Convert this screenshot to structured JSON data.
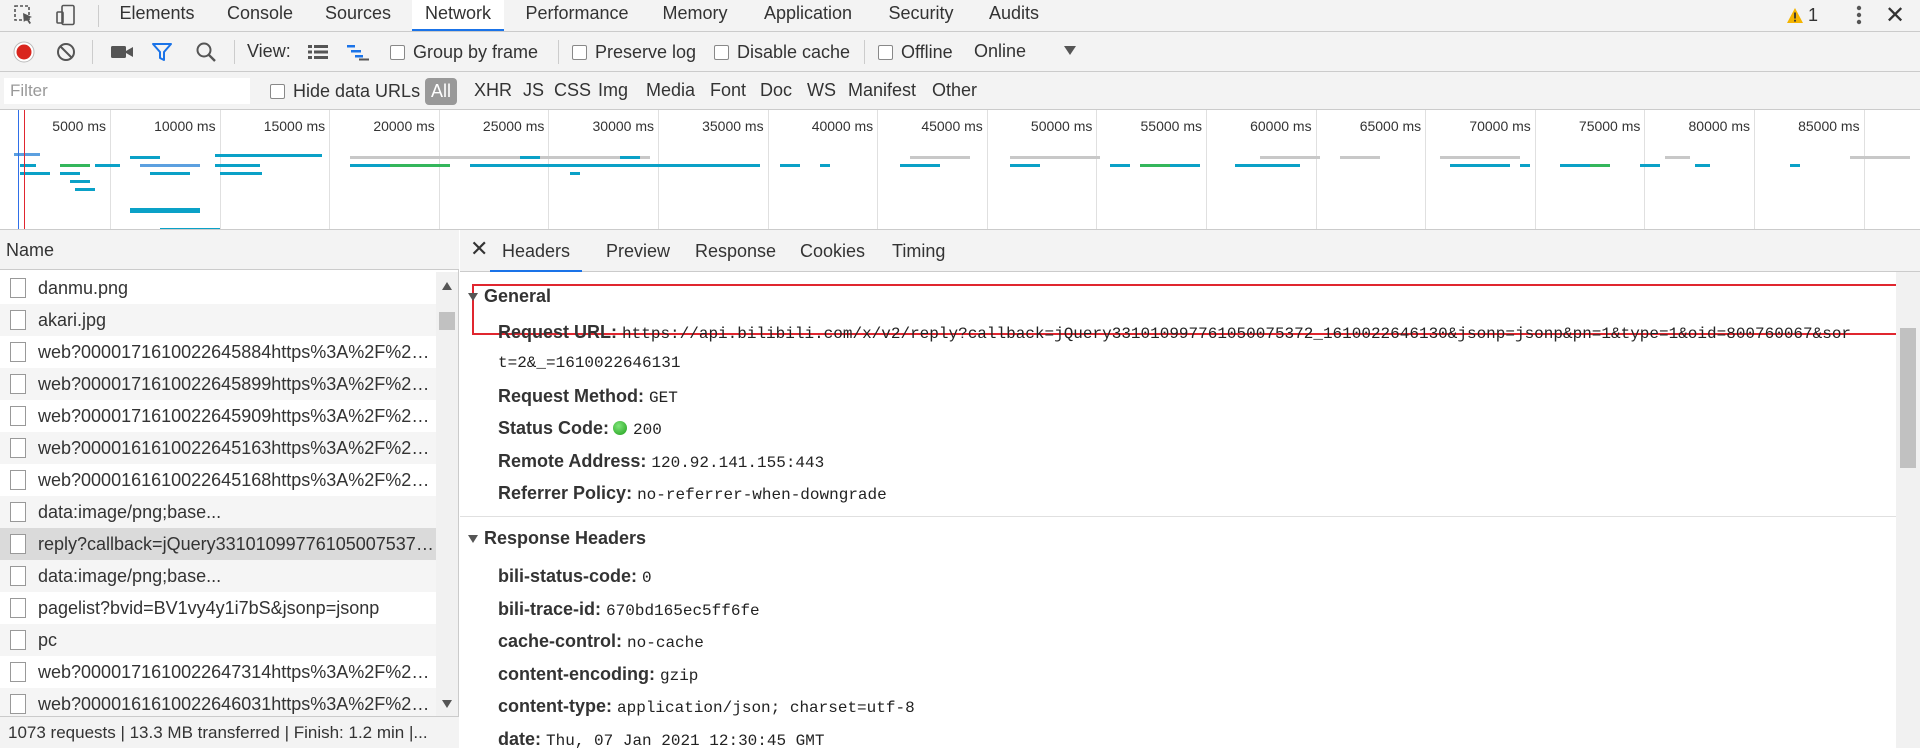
{
  "tabs": [
    {
      "label": "Elements",
      "active": false
    },
    {
      "label": "Console",
      "active": false
    },
    {
      "label": "Sources",
      "active": false
    },
    {
      "label": "Network",
      "active": true
    },
    {
      "label": "Performance",
      "active": false
    },
    {
      "label": "Memory",
      "active": false
    },
    {
      "label": "Application",
      "active": false
    },
    {
      "label": "Security",
      "active": false
    },
    {
      "label": "Audits",
      "active": false
    }
  ],
  "warnings": {
    "count": "1",
    "icon": "warning-icon"
  },
  "toolbar": {
    "view_label": "View:",
    "group_by_frame": "Group by frame",
    "preserve_log": "Preserve log",
    "disable_cache": "Disable cache",
    "offline": "Offline",
    "throttle": "Online"
  },
  "filterbar": {
    "placeholder": "Filter",
    "hide_data_urls": "Hide data URLs",
    "types": [
      "All",
      "XHR",
      "JS",
      "CSS",
      "Img",
      "Media",
      "Font",
      "Doc",
      "WS",
      "Manifest",
      "Other"
    ]
  },
  "overview": {
    "ticks": [
      "5000 ms",
      "10000 ms",
      "15000 ms",
      "20000 ms",
      "25000 ms",
      "30000 ms",
      "35000 ms",
      "40000 ms",
      "45000 ms",
      "50000 ms",
      "55000 ms",
      "60000 ms",
      "65000 ms",
      "70000 ms",
      "75000 ms",
      "80000 ms",
      "85000 ms",
      "9"
    ]
  },
  "requests": {
    "column": "Name",
    "rows": [
      {
        "name": "danmu.png"
      },
      {
        "name": "akari.jpg"
      },
      {
        "name": "web?000017161002264588​4https%3A%2F%2Fww..."
      },
      {
        "name": "web?0000171610022645899https%3A%2F%2Fww..."
      },
      {
        "name": "web?0000171610022645909https%3A%2F%2Fww..."
      },
      {
        "name": "web?0000161610022645163https%3A%2F%2Fww..."
      },
      {
        "name": "web?0000161610022645168https%3A%2F%2Fww..."
      },
      {
        "name": "data:image/png;base..."
      },
      {
        "name": "reply?callback=jQuery331010997761050075372_1..."
      },
      {
        "name": "data:image/png;base..."
      },
      {
        "name": "pagelist?bvid=BV1vy4y1i7bS&jsonp=jsonp"
      },
      {
        "name": "pc"
      },
      {
        "name": "web?0000171610022647314https%3A%2F%2Fww..."
      },
      {
        "name": "web?0000161610022646031https%3A%2F%2Fww..."
      }
    ],
    "status": "1073 requests  |  13.3 MB transferred  |  Finish: 1.2 min  |..."
  },
  "details": {
    "tabs": [
      "Headers",
      "Preview",
      "Response",
      "Cookies",
      "Timing"
    ],
    "general": {
      "title": "General",
      "request_url_key": "Request URL:",
      "request_url_line1": "https://api.bilibili.com/x/v2/reply?callback=jQuery331010997761050075372_1610022646130&jsonp=jsonp&pn=1&type=1&oid=800760067&sor",
      "request_url_line2": "t=2&_=1610022646131",
      "method_key": "Request Method:",
      "method": "GET",
      "status_key": "Status Code:",
      "status": "200",
      "remote_key": "Remote Address:",
      "remote": "120.92.141.155:443",
      "referrer_key": "Referrer Policy:",
      "referrer": "no-referrer-when-downgrade"
    },
    "response": {
      "title": "Response Headers",
      "headers": [
        {
          "k": "bili-status-code:",
          "v": "0"
        },
        {
          "k": "bili-trace-id:",
          "v": "670bd165ec5ff6fe"
        },
        {
          "k": "cache-control:",
          "v": "no-cache"
        },
        {
          "k": "content-encoding:",
          "v": "gzip"
        },
        {
          "k": "content-type:",
          "v": "application/json; charset=utf-8"
        },
        {
          "k": "date:",
          "v": "Thu, 07 Jan 2021 12:30:45 GMT"
        }
      ]
    }
  }
}
